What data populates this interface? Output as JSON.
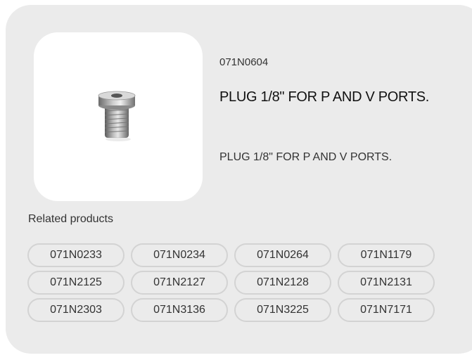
{
  "product": {
    "sku": "071N0604",
    "title": "PLUG 1/8\" FOR P AND V PORTS.",
    "description": "PLUG 1/8\" FOR P AND V PORTS.",
    "image_icon": "plug-image"
  },
  "related": {
    "label": "Related products",
    "items": [
      "071N0233",
      "071N0234",
      "071N0264",
      "071N1179",
      "071N2125",
      "071N2127",
      "071N2128",
      "071N2131",
      "071N2303",
      "071N3136",
      "071N3225",
      "071N7171"
    ]
  },
  "colors": {
    "card_background": "#ebebeb",
    "image_background": "#ffffff",
    "chip_border": "#d3d3d3"
  }
}
